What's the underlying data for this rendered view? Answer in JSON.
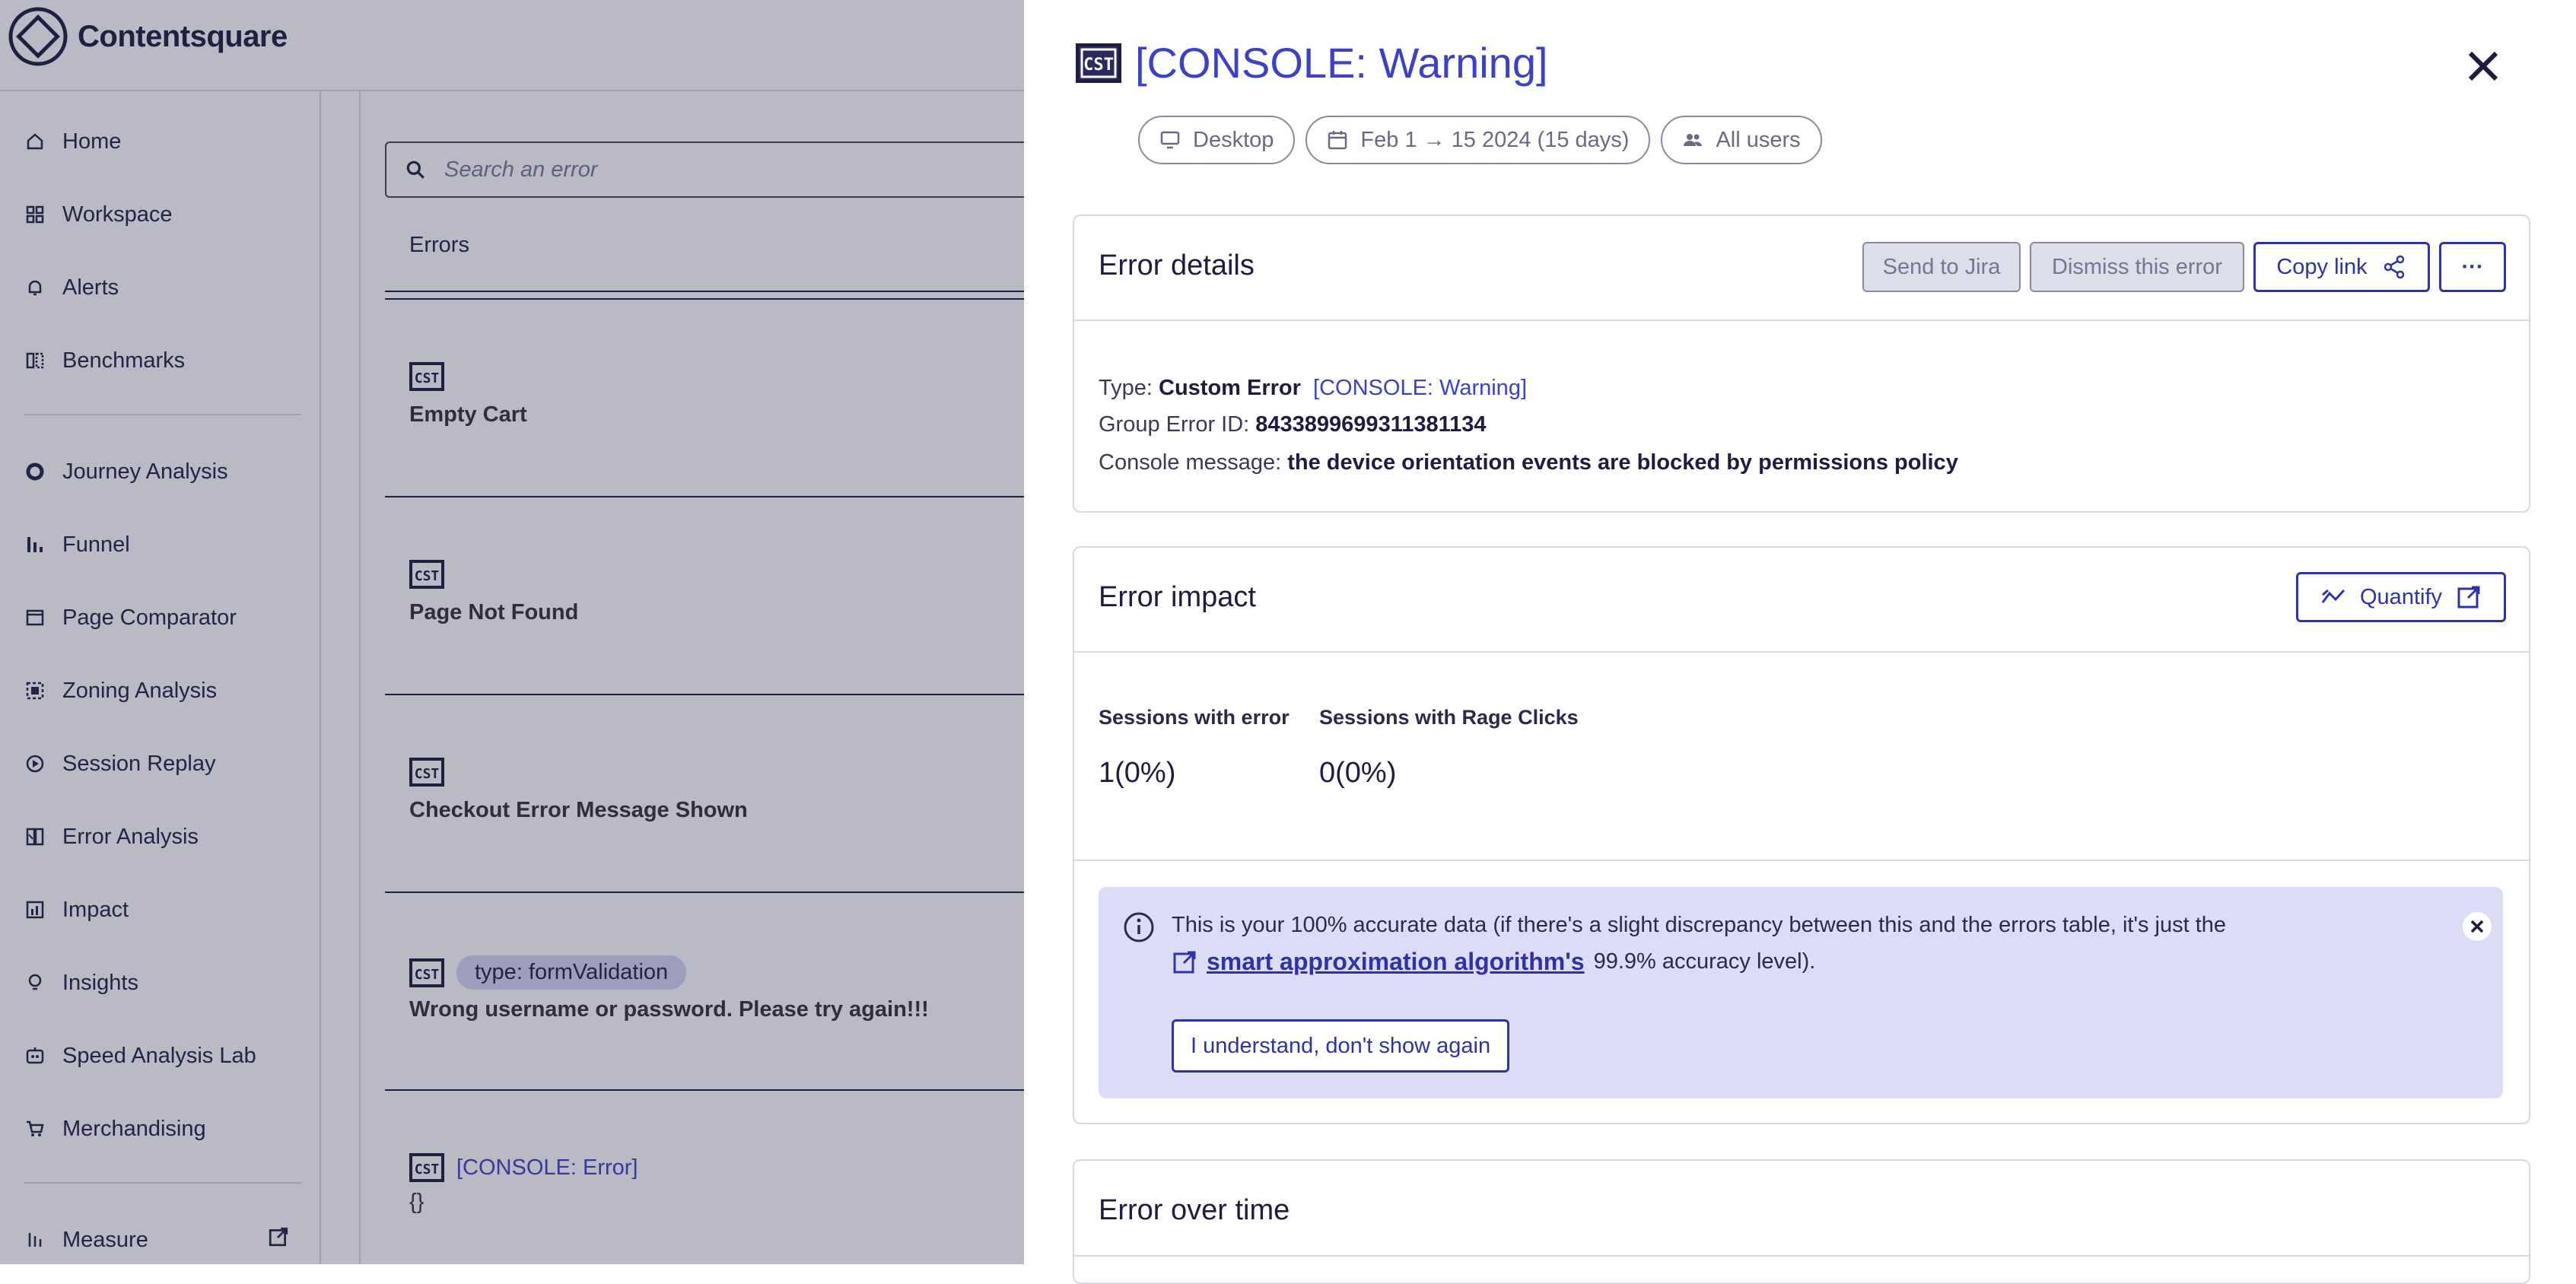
{
  "app": {
    "name": "Contentsquare"
  },
  "sidebar": {
    "items": [
      {
        "label": "Home",
        "icon": "home-icon"
      },
      {
        "label": "Workspace",
        "icon": "workspace-icon"
      },
      {
        "label": "Alerts",
        "icon": "bell-icon"
      },
      {
        "label": "Benchmarks",
        "icon": "benchmarks-icon"
      },
      {
        "label": "Journey Analysis",
        "icon": "journey-icon"
      },
      {
        "label": "Funnel",
        "icon": "funnel-icon"
      },
      {
        "label": "Page Comparator",
        "icon": "page-comparator-icon"
      },
      {
        "label": "Zoning Analysis",
        "icon": "zoning-icon"
      },
      {
        "label": "Session Replay",
        "icon": "play-icon"
      },
      {
        "label": "Error Analysis",
        "icon": "error-analysis-icon"
      },
      {
        "label": "Impact",
        "icon": "impact-icon"
      },
      {
        "label": "Insights",
        "icon": "lightbulb-icon"
      },
      {
        "label": "Speed Analysis Lab",
        "icon": "speed-icon"
      },
      {
        "label": "Merchandising",
        "icon": "cart-icon"
      },
      {
        "label": "Measure",
        "icon": "measure-icon"
      }
    ]
  },
  "main": {
    "search_placeholder": "Search an error",
    "errors_header": "Errors",
    "rows": [
      {
        "title": "Empty Cart"
      },
      {
        "title": "Page Not Found"
      },
      {
        "title": "Checkout Error Message Shown"
      },
      {
        "tag": "type: formValidation",
        "title": "Wrong username or password. Please try again!!!"
      },
      {
        "label": "[CONSOLE: Error]",
        "title": "{}"
      }
    ]
  },
  "panel": {
    "title": "[CONSOLE: Warning]",
    "filters": {
      "device": "Desktop",
      "date": "Feb 1 → 15 2024 (15 days)",
      "users": "All users"
    },
    "details": {
      "title": "Error details",
      "send_to_jira": "Send to Jira",
      "dismiss": "Dismiss this error",
      "copy_link": "Copy link",
      "more": "···",
      "type_label": "Type:",
      "type_value": "Custom Error",
      "type_tag": "[CONSOLE: Warning]",
      "group_label": "Group Error ID:",
      "group_value": "8433899699311381134",
      "console_label": "Console message:",
      "console_value": "the device orientation events are blocked by permissions policy"
    },
    "impact": {
      "title": "Error impact",
      "quantify": "Quantify",
      "sessions_error_label": "Sessions with error",
      "sessions_error_value": "1(0%)",
      "rage_label": "Sessions with Rage Clicks",
      "rage_value": "0(0%)",
      "info_text": "This is your 100% accurate data (if there's a slight discrepancy between this and the errors table, it's just the",
      "info_link": "smart approximation algorithm's",
      "info_tail": "99.9% accuracy level).",
      "ack_button": "I understand, don't show again"
    },
    "over_time": {
      "title": "Error over time"
    }
  },
  "colors": {
    "accent": "#2f32a8",
    "link": "#3d41c7",
    "info_bg": "#dcdcf7",
    "overlay": "#28284a"
  }
}
